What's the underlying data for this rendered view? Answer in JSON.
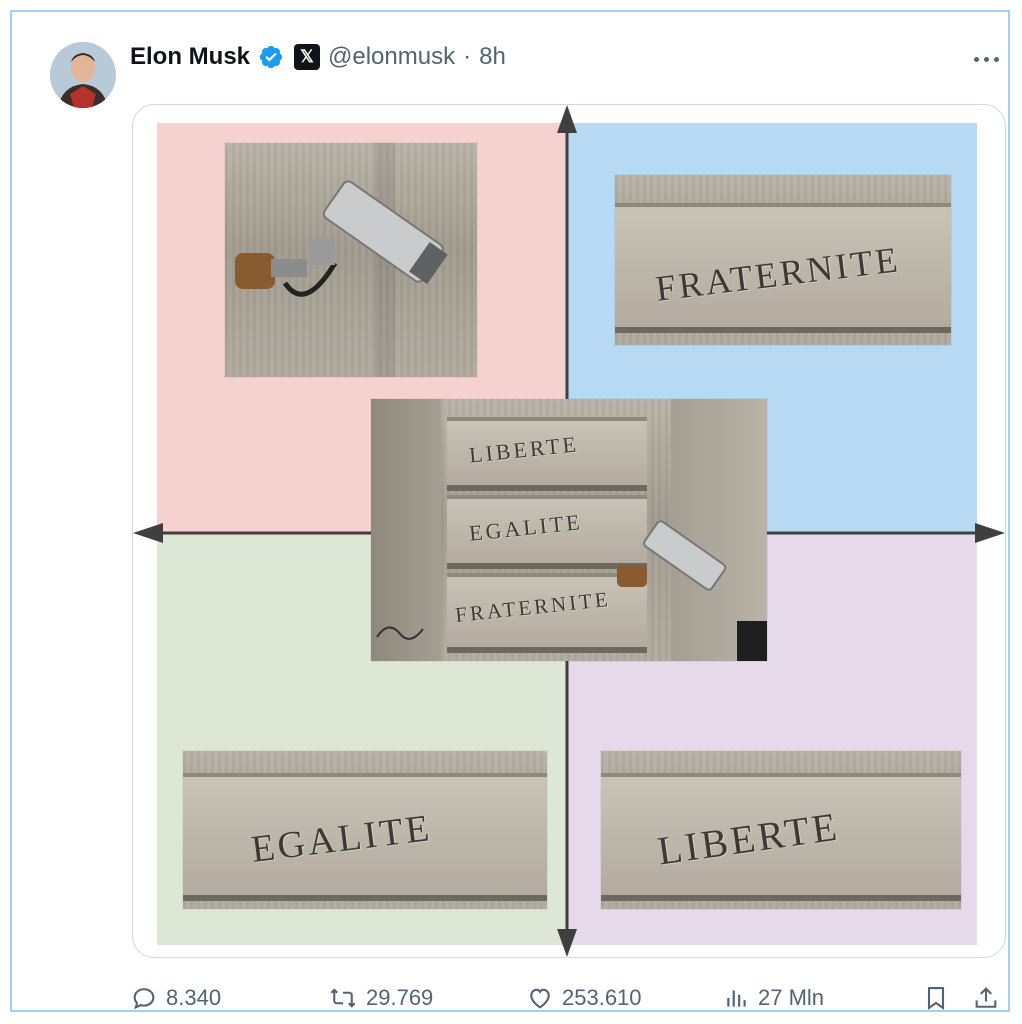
{
  "post": {
    "author_name": "Elon Musk",
    "handle": "@elonmusk",
    "separator": "·",
    "time": "8h",
    "x_badge": "𝕏"
  },
  "media": {
    "quadrant_colors": {
      "top_left": "#f5d2cf",
      "top_right": "#b8d9f3",
      "bottom_left": "#dde7d6",
      "bottom_right": "#e6d9ea"
    },
    "engravings": {
      "top_right": "FRATERNITE",
      "bottom_left": "EGALITE",
      "bottom_right": "LIBERTE",
      "center_line1": "LIBERTE",
      "center_line2": "EGALITE",
      "center_line3": "FRATERNITE"
    }
  },
  "actions": {
    "replies": "8.340",
    "reposts": "29.769",
    "likes": "253.610",
    "views": "27 Mln"
  },
  "icons": [
    "avatar",
    "verified-badge-icon",
    "x-logo-icon",
    "more-icon",
    "reply-icon",
    "repost-icon",
    "like-icon",
    "views-icon",
    "bookmark-icon",
    "share-icon"
  ],
  "colors": {
    "verified_blue": "#1d9bf0",
    "muted_text": "#536471",
    "frame_border": "#a9cdf0"
  }
}
